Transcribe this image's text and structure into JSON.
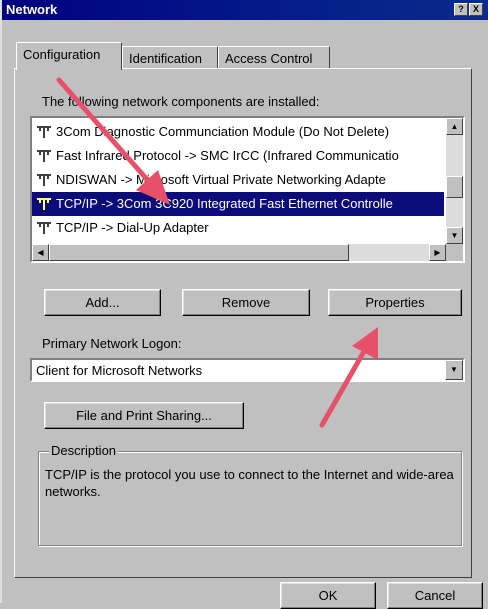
{
  "window": {
    "title": "Network",
    "title_buttons": [
      "?",
      "X"
    ]
  },
  "tabs": [
    {
      "label": "Configuration",
      "active": true
    },
    {
      "label": "Identification",
      "active": false
    },
    {
      "label": "Access Control",
      "active": false
    }
  ],
  "components": {
    "label": "The following network components are installed:",
    "items": [
      {
        "label": "3Com Diagnostic Communciation Module (Do Not Delete)",
        "selected": false,
        "icon": "network-adapter-icon"
      },
      {
        "label": "Fast Infrared Protocol -> SMC IrCC (Infrared Communicatio",
        "selected": false,
        "icon": "network-adapter-icon"
      },
      {
        "label": "NDISWAN -> Microsoft Virtual Private Networking Adapte",
        "selected": false,
        "icon": "network-adapter-icon"
      },
      {
        "label": "TCP/IP -> 3Com 3C920 Integrated Fast Ethernet Controlle",
        "selected": true,
        "icon": "network-adapter-icon"
      },
      {
        "label": "TCP/IP -> Dial-Up Adapter",
        "selected": false,
        "icon": "network-adapter-icon"
      }
    ]
  },
  "buttons": {
    "add": "Add...",
    "remove": "Remove",
    "properties": "Properties",
    "file_print_sharing": "File and Print Sharing...",
    "ok": "OK",
    "cancel": "Cancel"
  },
  "logon": {
    "label": "Primary Network Logon:",
    "value": "Client for Microsoft Networks"
  },
  "description": {
    "legend": "Description",
    "text": "TCP/IP is the protocol you use to connect to the Internet and wide-area networks."
  },
  "colors": {
    "titlebar": "#000080",
    "selection": "#0b0b7a",
    "arrow": "#e8506a"
  }
}
